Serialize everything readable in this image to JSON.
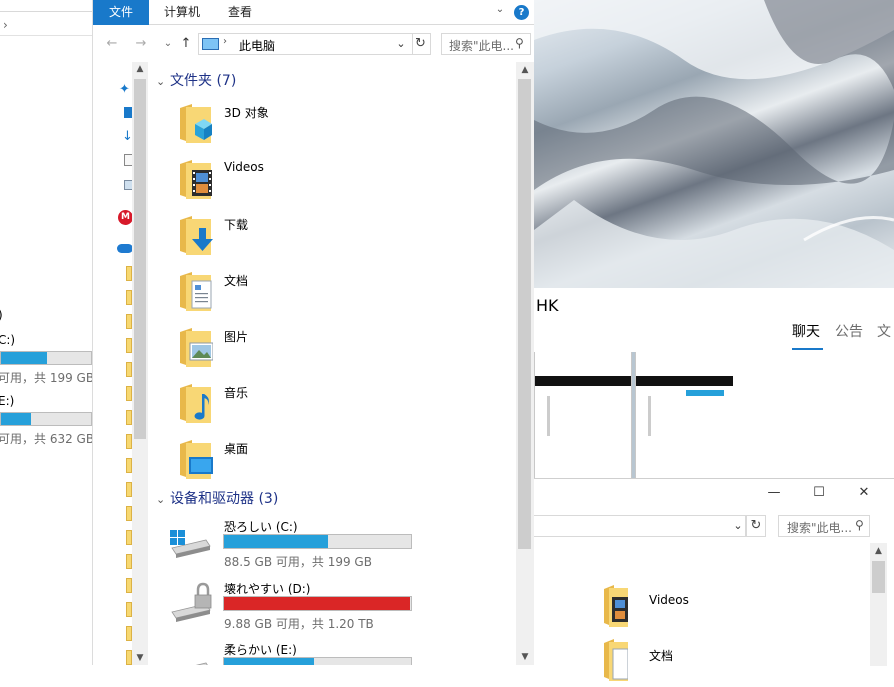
{
  "main_window": {
    "ribbon": {
      "tabs": [
        {
          "label": "文件",
          "active": true
        },
        {
          "label": "计算机",
          "active": false
        },
        {
          "label": "查看",
          "active": false
        }
      ],
      "help": "?"
    },
    "address": {
      "location": "此电脑",
      "back": "←",
      "forward": "→",
      "up": "↑"
    },
    "search": {
      "placeholder": "搜索\"此电..."
    },
    "groups": {
      "folders": {
        "title": "文件夹 (7)"
      },
      "devices": {
        "title": "设备和驱动器 (3)"
      }
    },
    "folders": [
      {
        "label": "3D 对象",
        "icon": "3d-objects-icon"
      },
      {
        "label": "Videos",
        "icon": "film-icon"
      },
      {
        "label": "下载",
        "icon": "download-arrow-icon"
      },
      {
        "label": "文档",
        "icon": "document-icon"
      },
      {
        "label": "图片",
        "icon": "picture-icon"
      },
      {
        "label": "音乐",
        "icon": "music-note-icon"
      },
      {
        "label": "桌面",
        "icon": "desktop-icon"
      }
    ],
    "drives": [
      {
        "name": "恐ろしい (C:)",
        "free_text": "88.5 GB 可用，共 199 GB",
        "used_fraction": 0.555,
        "bar_color": "#26a0da",
        "icon": "windows-drive-icon"
      },
      {
        "name": "壊れやすい (D:)",
        "free_text": "9.88 GB 可用，共 1.20 TB",
        "used_fraction": 0.992,
        "bar_color": "#da2626",
        "icon": "locked-drive-icon"
      },
      {
        "name": "柔らかい (E:)",
        "free_text": "",
        "used_fraction": 0.48,
        "bar_color": "#26a0da",
        "icon": "drive-icon"
      }
    ]
  },
  "left_background_window": {
    "chevron": "›",
    "drives": [
      {
        "name": "C:)",
        "free_text": "可用，共 199 GB",
        "used_fraction": 0.5
      },
      {
        "name": "E:)",
        "free_text": "可用，共 632 GB",
        "used_fraction": 0.33
      }
    ],
    "paren": ")"
  },
  "chat_panel": {
    "title": "HK",
    "tabs": [
      {
        "label": "聊天",
        "active": true
      },
      {
        "label": "公告",
        "active": false
      },
      {
        "label": "文",
        "active": false
      }
    ]
  },
  "second_window": {
    "search": {
      "placeholder": "搜索\"此电..."
    },
    "items": [
      {
        "label": "Videos"
      },
      {
        "label": "文档"
      }
    ]
  },
  "colors": {
    "accent": "#1979ca",
    "group_header": "#1e3287",
    "drive_blue": "#26a0da",
    "drive_red": "#da2626"
  }
}
